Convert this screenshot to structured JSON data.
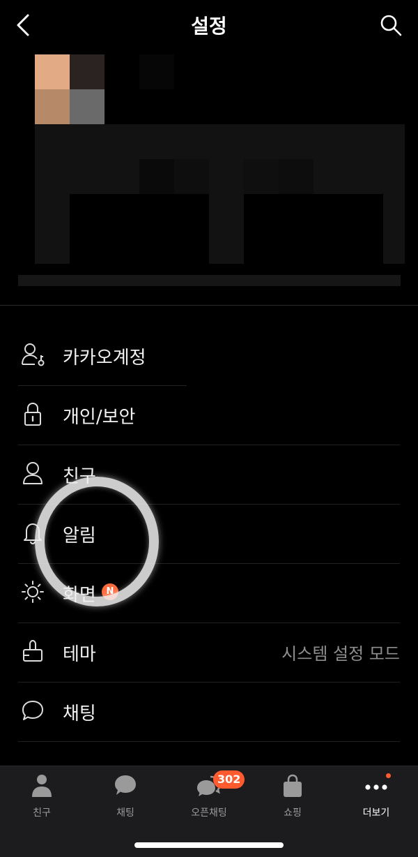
{
  "header": {
    "title": "설정",
    "back_icon": "chevron-left-icon",
    "search_icon": "search-icon"
  },
  "menu": {
    "items": [
      {
        "label": "카카오계정",
        "icon": "account-key-icon",
        "value": ""
      },
      {
        "label": "개인/보안",
        "icon": "lock-icon",
        "value": ""
      },
      {
        "label": "친구",
        "icon": "person-icon",
        "value": ""
      },
      {
        "label": "알림",
        "icon": "bell-icon",
        "value": ""
      },
      {
        "label": "화면",
        "icon": "brightness-icon",
        "value": "",
        "badge": "N"
      },
      {
        "label": "테마",
        "icon": "theme-brush-icon",
        "value": "시스템 설정 모드"
      },
      {
        "label": "채팅",
        "icon": "chat-bubble-icon",
        "value": ""
      }
    ]
  },
  "tabbar": {
    "tabs": [
      {
        "label": "친구",
        "icon": "person-icon"
      },
      {
        "label": "채팅",
        "icon": "chat-bubble-icon"
      },
      {
        "label": "오픈채팅",
        "icon": "open-chat-icon",
        "badge": "302"
      },
      {
        "label": "쇼핑",
        "icon": "shopping-bag-icon"
      },
      {
        "label": "더보기",
        "icon": "more-dots-icon",
        "active": true
      }
    ]
  },
  "colors": {
    "background": "#000000",
    "badge": "#ff5b2e",
    "tabbar": "#1c1c1e"
  }
}
